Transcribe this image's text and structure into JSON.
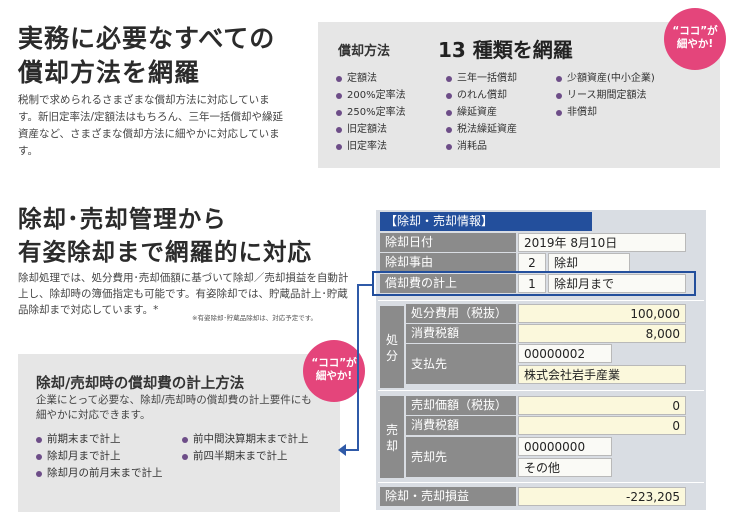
{
  "section1": {
    "title_line1": "実務に必要なすべての",
    "title_line2": "償却方法を網羅",
    "desc": "税制で求められるさまざまな償却方法に対応しています。新旧定率法/定額法はもちろん、三年一括償却や繰延資産など、さまざまな償却方法に細やかに対応しています。",
    "box_label": "償却方法",
    "box_headline": "13 種類を網羅",
    "methods_col1": [
      "定額法",
      "200%定率法",
      "250%定率法",
      "旧定額法",
      "旧定率法"
    ],
    "methods_col2": [
      "三年一括償却",
      "のれん償却",
      "繰延資産",
      "税法繰延資産",
      "消耗品"
    ],
    "methods_col3": [
      "少額資産(中小企業)",
      "リース期間定額法",
      "非償却"
    ]
  },
  "badge": {
    "line1": "“ココ”が",
    "line2": "細やか!"
  },
  "section2": {
    "title_line1": "除却･売却管理から",
    "title_line2": "有姿除却まで網羅的に対応",
    "desc": "除却処理では、処分費用･売却価額に基づいて除却／売却損益を自動計上し、除却時の簿価指定も可能です。有姿除却では、貯蔵品計上･貯蔵品除却まで対応しています。*",
    "note": "※有姿除却･貯蔵品除却は、対応予定です。",
    "box_title": "除却/売却時の償却費の計上方法",
    "box_desc": "企業にとって必要な、除却/売却時の償却費の計上要件にも細やかに対応できます。",
    "options_col1": [
      "前期末まで計上",
      "除却月まで計上",
      "除却月の前月末まで計上"
    ],
    "options_col2": [
      "前中間決算期末まで計上",
      "前四半期末まで計上"
    ]
  },
  "form": {
    "header": "【除却・売却情報】",
    "date_label": "除却日付",
    "date_value": "2019年  8月10日",
    "reason_label": "除却事由",
    "reason_code": "2",
    "reason_value": "除却",
    "dep_label": "償却費の計上",
    "dep_code": "1",
    "dep_value": "除却月まで",
    "disposal_side": "処分",
    "disposal_cost_label": "処分費用（税抜）",
    "disposal_cost_value": "100,000",
    "disposal_tax_label": "消費税額",
    "disposal_tax_value": "8,000",
    "payee_label": "支払先",
    "payee_code": "00000002",
    "payee_name": "株式会社岩手産業",
    "sale_side": "売却",
    "sale_price_label": "売却価額（税抜）",
    "sale_price_value": "0",
    "sale_tax_label": "消費税額",
    "sale_tax_value": "0",
    "buyer_label": "売却先",
    "buyer_code": "00000000",
    "buyer_name": "その他",
    "pl_label": "除却・売却損益",
    "pl_value": "-223,205"
  }
}
